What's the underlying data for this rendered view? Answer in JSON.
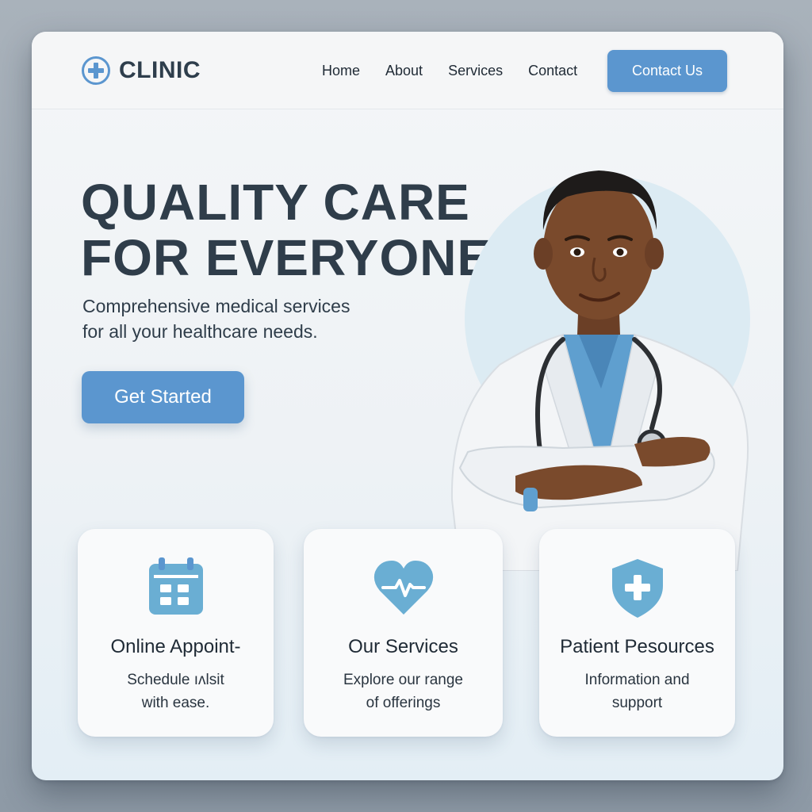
{
  "brand": {
    "name": "CLINIC",
    "icon": "medical-cross-icon"
  },
  "nav": {
    "items": [
      "Home",
      "About",
      "Services",
      "Contact"
    ],
    "cta_label": "Contact Us"
  },
  "hero": {
    "title_line1": "QUALITY CARE",
    "title_line2": "FOR EVERYONE",
    "subtitle_line1": "Comprehensive medical services",
    "subtitle_line2": "for all your healthcare needs.",
    "button_label": "Get Started"
  },
  "cards": [
    {
      "icon": "calendar-icon",
      "title": "Online Appoint-",
      "desc_line1": "Schedule ıʌlsit",
      "desc_line2": "with ease."
    },
    {
      "icon": "heart-pulse-icon",
      "title": "Our Services",
      "desc_line1": "Explore our range",
      "desc_line2": "of offerings"
    },
    {
      "icon": "shield-plus-icon",
      "title": "Patient Pesources",
      "desc_line1": "Information and",
      "desc_line2": "support"
    }
  ],
  "colors": {
    "accent": "#5b96cf",
    "heading": "#2f3d4a",
    "icon_fill": "#6aaed3",
    "page_background": "#9aa5b0"
  }
}
